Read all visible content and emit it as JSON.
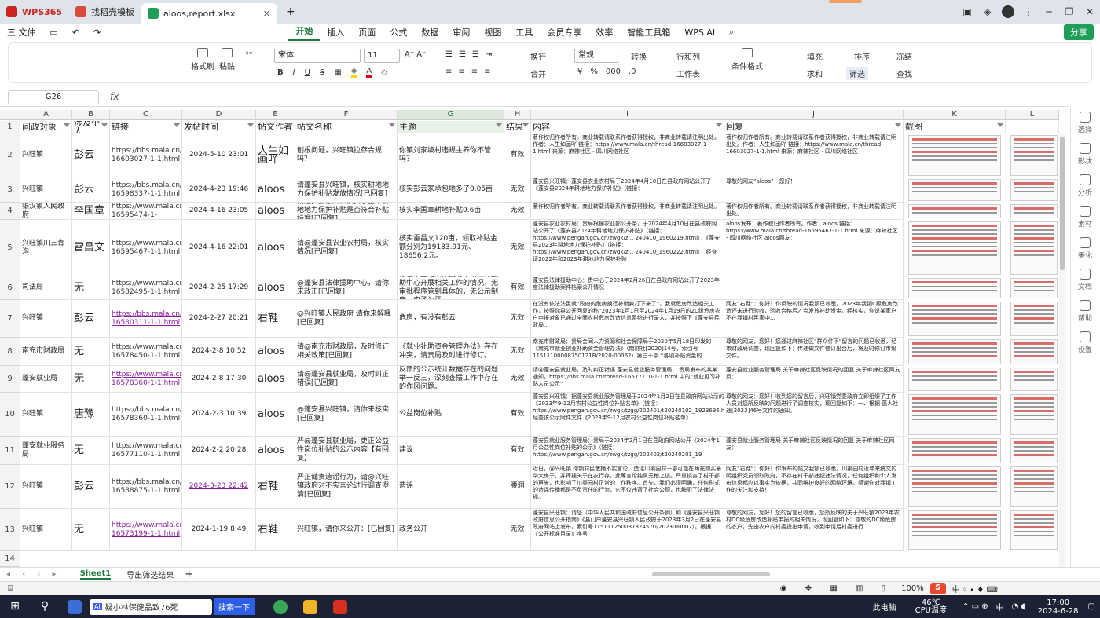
{
  "titlebar": {
    "tabs": [
      {
        "label": "WPS365"
      },
      {
        "label": "找稻壳模板"
      },
      {
        "label": "aloos,report.xlsx"
      }
    ],
    "new_tab": "+",
    "window_controls": [
      "─",
      "❐",
      "✕"
    ]
  },
  "menubar": {
    "file": "三 文件",
    "items": [
      "开始",
      "插入",
      "页面",
      "公式",
      "数据",
      "审阅",
      "视图",
      "工具",
      "会员专享",
      "效率",
      "智能工具箱"
    ],
    "wps_ai": "WPS AI",
    "share": "分享"
  },
  "ribbon": {
    "format_painter": "格式刷",
    "paste": "粘贴",
    "font_name": "宋体",
    "font_size": "11",
    "wrap": "换行",
    "merge": "合并",
    "number_format": "常规",
    "convert": "转换",
    "rows_cols": "行和列",
    "worksheet": "工作表",
    "cond_format": "条件格式",
    "fill": "填充",
    "sort": "排序",
    "freeze": "冻结",
    "sum": "求和",
    "filter": "筛选",
    "find": "查找"
  },
  "formula_bar": {
    "cell_ref": "G26",
    "fx": "fx",
    "value": ""
  },
  "columns": [
    "A",
    "B",
    "C",
    "D",
    "E",
    "F",
    "G",
    "H",
    "I",
    "J",
    "K",
    "L"
  ],
  "header_row": [
    "问政对象",
    "涉及个人",
    "链接",
    "发帖时间",
    "帖文作者",
    "帖文名称",
    "主题",
    "结果",
    "内容",
    "回复",
    "截图",
    ""
  ],
  "rows": [
    {
      "n": "2",
      "a": "兴旺镇",
      "b": "彭云",
      "c": "https://bbs.mala.cn/thread-16603027-1-1.html",
      "d": "2024-5-10 23:01",
      "e": "人生如画吖",
      "f": "刨根问题，兴旺镇拉存合规吗？",
      "g": "你镇刘家坡村违规主养你不管吗？",
      "h": "有效",
      "i": "著作权归作者所有。商业转载请联系作者获得授权，非商业转载请注明出处。作者：人生如画吖 链接：https://www.mala.cn/thread-16603027-1-1.html 来源：麻辣社区 - 四川网络社区",
      "j": "著作权归作者所有。商业转载请联系作者获得授权，非商业转载请注明出处。作者：人生如画吖 链接：https://www.mala.cn/thread-16603027-1-1.html 来源：麻辣社区 - 四川网络社区"
    },
    {
      "n": "3",
      "a": "兴旺镇",
      "b": "彭云",
      "c": "https://bbs.mala.cn/thread-16598337-1-1.html",
      "d": "2024-4-23 19:46",
      "e": "aloos",
      "f": "请蓬安县兴旺镇，核实耕地地力保护补贴发放情况[已回复]",
      "g": "核实彭云家承包地多了0.05亩",
      "h": "无效",
      "i": "蓬安县兴旺镇：蓬安县农业农村局于2024年4月10日在县政府网站公开了《蓬安县2024年耕地地力保护补贴》（链接：",
      "j": "尊敬的网友“aloos”：您好！"
    },
    {
      "n": "4",
      "a": "银汉镇人民政府",
      "b": "李国章",
      "c": "https://www.mala.cn/thread-16595474-1-",
      "d": "2024-4-16 23:05",
      "e": "aloos",
      "f": "请蓬安县银汉镇核实李国章耕地地力保护补贴是否符合补贴标准[已回复]",
      "g": "核实李国章耕地补贴0.6亩",
      "h": "无效",
      "i": "著作权归作者所有。商业转载请联系作者获得授权，非商业转载请注明出处。",
      "j": "著作权归作者所有。商业转载请联系作者获得授权，非商业转载请注明出处。"
    },
    {
      "n": "5",
      "a": "兴旺镇川三青沟",
      "b": "雷昌文",
      "c": "https://www.mala.cn/thread-16595467-1-1.html",
      "d": "2024-4-16 22:01",
      "e": "aloos",
      "f": "请@蓬安县农业农村局，核实情况[已回复]",
      "g": "核实雷昌文120亩，领取补贴金额分别为19183.91元、18656.2元。",
      "h": "无效",
      "i": "蓬安县农业农村局：贵局根据农业部公开条，于2024年4月10日在县政府网站公开了《蓬安县2024年耕地地力保护补贴》（链接：https://www.pengan.gov.cn/zwgk/z... 240410_1960219.html），《蓬安县2023年耕地地力保护补贴》（链接：https://www.pengan.gov.cn/zwgk/z... 240410_1960222.html），经查证2022年和2023年耕地地力保护补贴",
      "j": "aloos发布；著作权归作者所有。作者：aloos 链接：https://www.mala.cn/thread-16595467-1-1.html 来源：麻辣社区 - 四川网络社区 aloos网友："
    },
    {
      "n": "6",
      "a": "司法局",
      "b": "无",
      "c": "https://www.mala.cn/thread-16582495-1-1.html",
      "d": "2024-2-25 17:29",
      "e": "aloos",
      "f": "@蓬安县法律援助中心，请你来政正[已回复]",
      "g": "存在未登记法律援助申请法律援助中心开展相关工作的情况，无审批程序管到具体的，无公示制度，应予为牙",
      "h": "有效",
      "i": "蓬安县法律援助中心：贵中心于2024年2月26日在县政府网站公开了2023年度法律援助案件档案公开情况",
      "j": ""
    },
    {
      "n": "7",
      "a": "兴旺镇",
      "b": "彭云",
      "c": "https://bbs.mala.cn/thread-16580311-1-1.html",
      "d": "2024-2-27 20:21",
      "e": "右鞋",
      "f": "@兴旺镇人民政府 请你来解释[已回复]",
      "g": "危房，有没有彭云",
      "h": "无效",
      "i": "在没有依法法民就“政府的危房换迁补助款打下来了”，我就危房改造相关工作，按照你县公开回复的称“2023年1月1日至2024年1月19日的2C级危房农户申报对象已通过全面农村危房改造信息系统进行录入，并按照下《蓬安县民政局...",
      "j": "网友“右鞋”：你好！你反映的情况我镇已收悉。2023年我镇C级危房改造还未进行验收，验收合格后才会发放补助资金。经核实，你说某家户不在我镇村民家中..."
    },
    {
      "n": "8",
      "a": "南充市财政局",
      "b": "无",
      "c": "https://www.mala.cn/thread-16578450-1-1.html",
      "d": "2024-2-8 10:52",
      "e": "aloos",
      "f": "请@南充市财政局，及时修订相关政策[已回复]",
      "g": "《就业补助资金管理办法》存在冲突，请贵局及时进行修订。",
      "h": "无效",
      "i": "南充市财政局：贵局会同人力资源和社会保障局于2020年5月18日印发的《南充市就业创业补助资金管理办法》（南财社[2020]14号，索引号11511100008750121B/2020-00062）第三十条 “各项补贴资金的",
      "j": "尊敬的网友，您好！您通过麻辣社区“群众件下”留言的问题已收悉，经市财政局调查，现回复如下：传递做文件修订出台后，将及时修订市级文件。"
    },
    {
      "n": "9",
      "a": "蓬安就业局",
      "b": "无",
      "c": "https://www.mala.cn/thread-16578360-1-1.html",
      "d": "2024-2-8 17:30",
      "e": "aloos",
      "f": "请@蓬安县就业局，及时纠正错误[已回复]",
      "g": "反馈的公示统计数据存在的问题举一反三，深刻查摆工作中存在的作风问题。",
      "h": "无效",
      "i": "请@蓬安县就业局，及时纠正错误 蓬安县就业服务管理局... 贵局发布的某某通知，https://bbs.mala.cn/thread-16577110-1-1.html 中的“就业见习补贴人员公示”",
      "j": "蓬安县就业服务管理局 关于麻辣社区反映情况的回复 关于麻辣社区网友反："
    },
    {
      "n": "10",
      "a": "兴旺镇",
      "b": "唐豫",
      "c": "https://bbs.mala.cn/thread-16578360-1-1.html",
      "d": "2024-2-3 10:39",
      "e": "aloos",
      "f": "@蓬安县兴旺镇，请你来核实[已回复]",
      "g": "公益岗位补贴",
      "h": "有效",
      "i": "蓬安县兴旺镇：据蓬安县就业服务管理局于2024年1月2日在县政府网站公示的《2023年9-12月农村公益性岗位补贴名单》（链接：https://www.pengan.gov.cn/zwgk/tzgg/202401/t20240102_1923696.html），经查该公示附件文件《2023年9-12月农村公益性岗位补贴名单》",
      "j": "尊敬的网友：您好！收到您的留言后，兴旺镇党委政府立即组织了工作人员对您所反映的问题进行了调查核实，现回复如下：一、根据 蓬人社通[2023]46号文件的通知。"
    },
    {
      "n": "11",
      "a": "蓬安就业服务局",
      "b": "无",
      "c": "https://www.mala.cn/thread-16577110-1-1.html",
      "d": "2024-2-2 20:28",
      "e": "aloos",
      "f": "严@蓬安县就业局，更正公益性岗位补贴的公示内容【有回复】",
      "g": "建议",
      "h": "有效",
      "i": "蓬安县就业服务管理局：贵局于2024年2月1日在县政府网站公开《2024年1月公益性岗位补贴的公示》（链接：https://www.pengan.gov.cn/zwgk/tzgg/202402/t20240201_19",
      "j": "蓬安县就业服务管理局 关于麻辣社区反映情况的回复 关于麻辣社区网友："
    },
    {
      "n": "12",
      "a": "兴旺镇",
      "b": "彭云",
      "c": "https://bbs.mala.cn/thread-16588875-1-1.html",
      "d": "2024-3-23 22:42",
      "e": "右鞋",
      "f": "严正谴责造谣行为，请@兴旺镇政府对不实言论进行调查澄清[已回复]",
      "g": "造谣",
      "h": "腰洞",
      "i": "近日，@兴旺镇 你镇村民散播不实言论，造谣川渠园村干部可能在两充购买豪华大房子，并摔撞关于在农行存，此等言论纯属无稽之谈。严重损害了村干部的声誉，也影响了川渠园村正常的工作秩序。首先，我们必须明确，任何形式的造谣传播都是不负责任的行为，它不仅违背了社会公德，也触犯了法律法规。",
      "j": "网友“右鞋”：你好！你发布的帖文我镇已收悉。川渠园村近年来统文的明组织党员领取政府，不存在村干部违纪违法情况，任何组织和个人发布信息都应以事实为依据，共同维护良好的网络环境。感谢你对我镇工作的关注和支持！"
    },
    {
      "n": "13",
      "a": "兴旺镇",
      "b": "无",
      "c": "https://www.mala.cn/thread-16573199-1-1.html",
      "d": "2024-1-19 8:49",
      "e": "右鞋",
      "f": "兴旺镇，请你来公开：[已回复]",
      "g": "政务公开",
      "h": "无效",
      "i": "蓬安县兴旺镇：请您（中华人民共和国政府信息公开条例）和《蓬安县兴旺镇政府信息公开指南》《县门户蓬安县兴旺镇人民政府于2023年3月2日在蓬安县政府网站上发布，索引号11511125008782457U/2023-00007）。根据《公开标准目录》序号",
      "j": "尊敬的网友，您好！您的留言已收悉，您所反映的关于兴旺镇2023年农村DC级危房改造补贴申报的相关情况，现回复如下：尊敬的DC级危房的农户，先由农户向村委提出申请，收到申请后村委进行"
    }
  ],
  "sheet_tabs": {
    "active": "Sheet1",
    "other": "导出筛选结果",
    "add": "+"
  },
  "status": {
    "zoom": "100%"
  },
  "right_panel": [
    "选择",
    "形状",
    "分析",
    "素材",
    "美化",
    "文档",
    "帮助",
    "设置"
  ],
  "taskbar": {
    "search_text": "疑小林保健品致76死",
    "search_button": "搜索一下",
    "tray_label": "此电脑",
    "temp": "46℃",
    "temp_label": "CPU温度",
    "ime": "中",
    "time": "17:00",
    "date": "2024-6-28"
  }
}
